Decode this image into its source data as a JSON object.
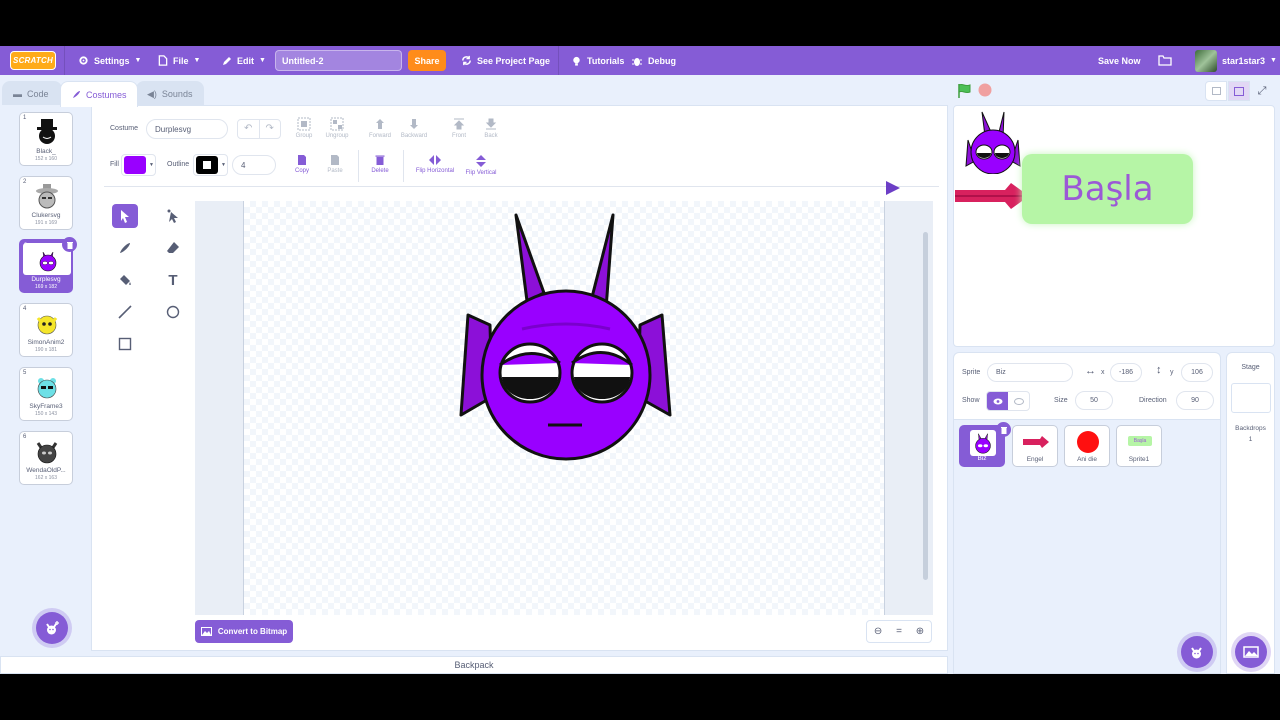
{
  "menubar": {
    "logo": "SCRATCH",
    "settings": "Settings",
    "file": "File",
    "edit": "Edit",
    "project_title": "Untitled-2",
    "share": "Share",
    "see_project_page": "See Project Page",
    "tutorials": "Tutorials",
    "debug": "Debug",
    "save_now": "Save Now",
    "username": "star1star3"
  },
  "tabs": {
    "code": "Code",
    "costumes": "Costumes",
    "sounds": "Sounds"
  },
  "costumes": [
    {
      "num": "1",
      "name": "Black_",
      "size": "152 x 160"
    },
    {
      "num": "2",
      "name": "Clukersvg",
      "size": "191 x 169"
    },
    {
      "num": "3",
      "name": "Durplesvg",
      "size": "169 x 182",
      "selected": true
    },
    {
      "num": "4",
      "name": "SimonAnim2",
      "size": "190 x 181"
    },
    {
      "num": "5",
      "name": "SkyFrame3",
      "size": "150 x 143"
    },
    {
      "num": "6",
      "name": "WendaOldP...",
      "size": "162 x 163"
    }
  ],
  "toolbar": {
    "costume_label": "Costume",
    "costume_name": "Durplesvg",
    "group": "Group",
    "ungroup": "Ungroup",
    "forward": "Forward",
    "backward": "Backward",
    "front": "Front",
    "back": "Back",
    "fill_label": "Fill",
    "fill_color": "#9900ff",
    "outline_label": "Outline",
    "outline_color": "#000000",
    "outline_width": "4",
    "copy": "Copy",
    "paste": "Paste",
    "delete": "Delete",
    "flip_horizontal": "Flip Horizontal",
    "flip_vertical": "Flip Vertical"
  },
  "convert_button": "Convert to Bitmap",
  "backpack": "Backpack",
  "stage": {
    "start_text": "Başla"
  },
  "sprite_info": {
    "sprite_label": "Sprite",
    "sprite_name": "Biz",
    "x_label": "x",
    "x": "-186",
    "y_label": "y",
    "y": "106",
    "show_label": "Show",
    "size_label": "Size",
    "size": "50",
    "direction_label": "Direction",
    "direction": "90"
  },
  "sprites": [
    {
      "name": "Biz",
      "selected": true
    },
    {
      "name": "Engel"
    },
    {
      "name": "Ani die"
    },
    {
      "name": "Sprite1"
    }
  ],
  "sprite1_thumb_text": "Başla",
  "stage_panel": {
    "title": "Stage",
    "backdrops_label": "Backdrops",
    "backdrops_count": "1"
  },
  "colors": {
    "accent": "#855cd6",
    "orange": "#ff8c1a",
    "bg": "#e9f0fc"
  }
}
